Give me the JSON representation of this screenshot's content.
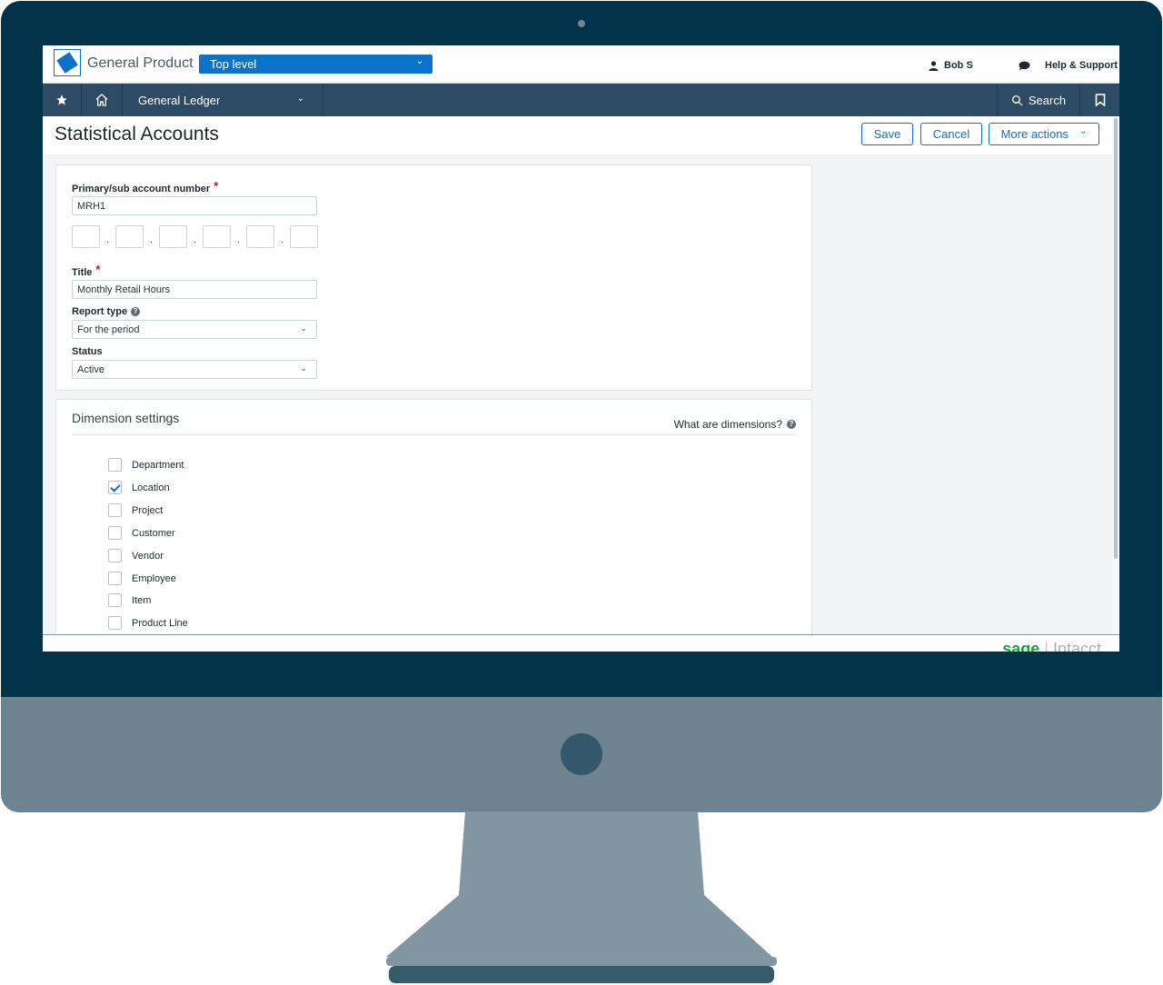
{
  "header": {
    "company_name": "General Product",
    "entity_selector": "Top level",
    "user_name": "Bob S",
    "help_label": "Help & Support"
  },
  "nav": {
    "module": "General Ledger",
    "search_label": "Search"
  },
  "page": {
    "title": "Statistical Accounts",
    "save_label": "Save",
    "cancel_label": "Cancel",
    "more_actions_label": "More actions"
  },
  "form": {
    "account_number": {
      "label": "Primary/sub account number",
      "value": "MRH1"
    },
    "title": {
      "label": "Title",
      "value": "Monthly Retail Hours"
    },
    "report_type": {
      "label": "Report type",
      "value": "For the period"
    },
    "status": {
      "label": "Status",
      "value": "Active"
    }
  },
  "dimensions": {
    "heading": "Dimension settings",
    "help_link": "What are dimensions?",
    "items": [
      {
        "label": "Department",
        "checked": false
      },
      {
        "label": "Location",
        "checked": true
      },
      {
        "label": "Project",
        "checked": false
      },
      {
        "label": "Customer",
        "checked": false
      },
      {
        "label": "Vendor",
        "checked": false
      },
      {
        "label": "Employee",
        "checked": false
      },
      {
        "label": "Item",
        "checked": false
      },
      {
        "label": "Product Line",
        "checked": false
      }
    ]
  },
  "footer": {
    "brand_primary": "sage",
    "brand_secondary": "Intacct"
  },
  "colors": {
    "accent": "#0b72c9",
    "navbar": "#2d4b64",
    "bezel": "#02334a",
    "required": "#c8102e"
  }
}
